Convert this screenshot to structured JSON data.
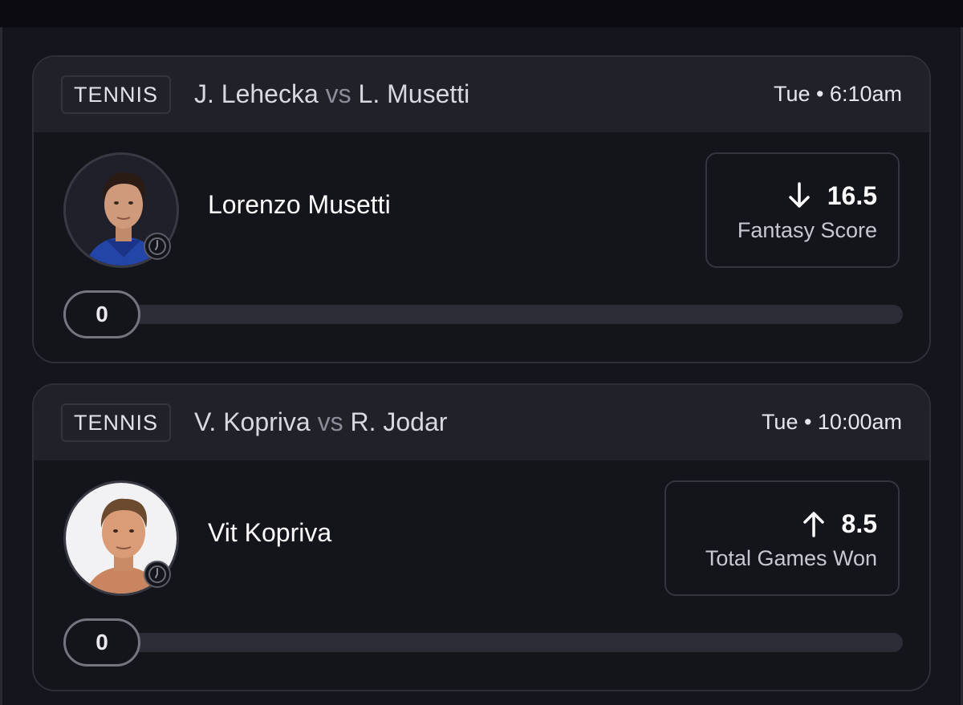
{
  "picks": [
    {
      "sport": "TENNIS",
      "player_one": "J. Lehecka",
      "vs_label": "vs",
      "player_two": "L. Musetti",
      "game_time": "Tue • 6:10am",
      "player_name": "Lorenzo Musetti",
      "direction": "down",
      "direction_icon": "arrow-down-icon",
      "line_value": "16.5",
      "stat_label": "Fantasy Score",
      "current_value": "0",
      "progress_fraction": 0
    },
    {
      "sport": "TENNIS",
      "player_one": "V. Kopriva",
      "vs_label": "vs",
      "player_two": "R. Jodar",
      "game_time": "Tue • 10:00am",
      "player_name": "Vit Kopriva",
      "direction": "up",
      "direction_icon": "arrow-up-icon",
      "line_value": "8.5",
      "stat_label": "Total Games Won",
      "current_value": "0",
      "progress_fraction": 0
    }
  ],
  "colors": {
    "background": "#15151d",
    "card": "#14141b",
    "card_header": "#21212a",
    "border": "#2f2f39",
    "track": "#2c2c36"
  }
}
